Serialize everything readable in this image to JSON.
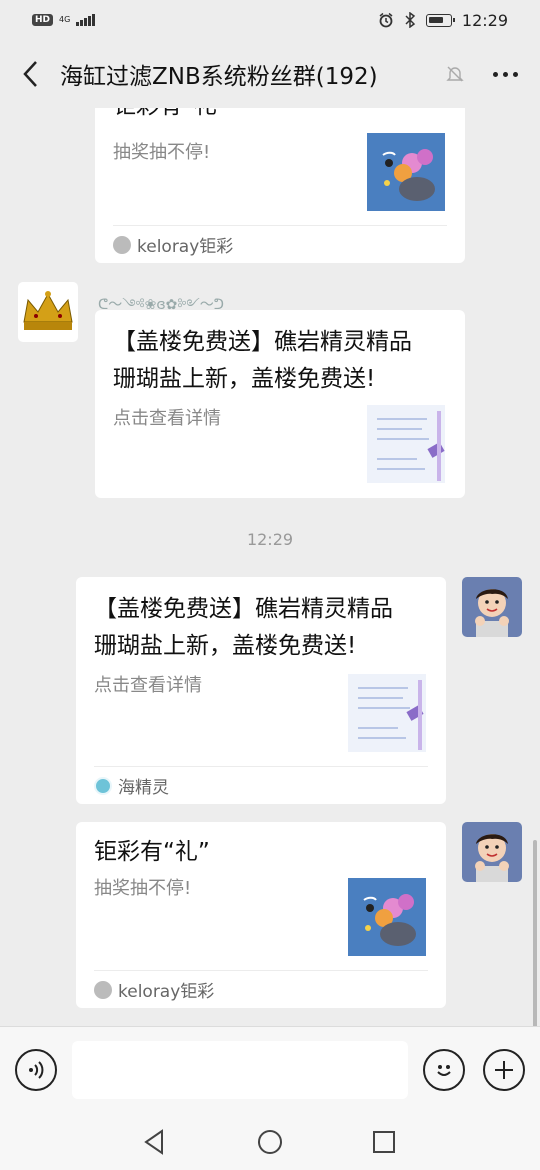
{
  "status_bar": {
    "hd": "HD",
    "network": "4G",
    "time": "12:29",
    "icons": [
      "alarm-icon",
      "bluetooth-icon",
      "battery-icon"
    ]
  },
  "nav": {
    "title": "海缸过滤ZNB系统粉丝群(192)",
    "icons": [
      "back-chevron-icon",
      "mute-bell-icon",
      "more-dots-icon"
    ]
  },
  "messages": [
    {
      "title_fragment": "钜彩有“礼”",
      "desc": "抽奖抽不停!",
      "source": "keloray钜彩"
    },
    {
      "sender": "ᕦ〜༺❀ɞ✿༻〜ᕤ",
      "title": [
        "【盖楼免费送】礁岩精灵精品",
        "珊瑚盐上新，盖楼免费送!"
      ],
      "desc": "点击查看详情"
    },
    {
      "time": "12:29"
    },
    {
      "title": [
        "【盖楼免费送】礁岩精灵精品",
        "珊瑚盐上新，盖楼免费送!"
      ],
      "desc": "点击查看详情",
      "source": "海精灵"
    },
    {
      "title": "钜彩有“礼”",
      "desc": "抽奖抽不停!",
      "source": "keloray钜彩"
    }
  ],
  "input_bar": {
    "placeholder": "",
    "icons": [
      "voice-icon",
      "emoji-icon",
      "plus-icon"
    ]
  },
  "system_nav": {
    "icons": [
      "back-triangle-icon",
      "home-circle-icon",
      "recents-square-icon"
    ]
  },
  "colors": {
    "background": "#ededed",
    "card": "#ffffff",
    "title_text": "#111111",
    "desc_text": "#888888"
  }
}
